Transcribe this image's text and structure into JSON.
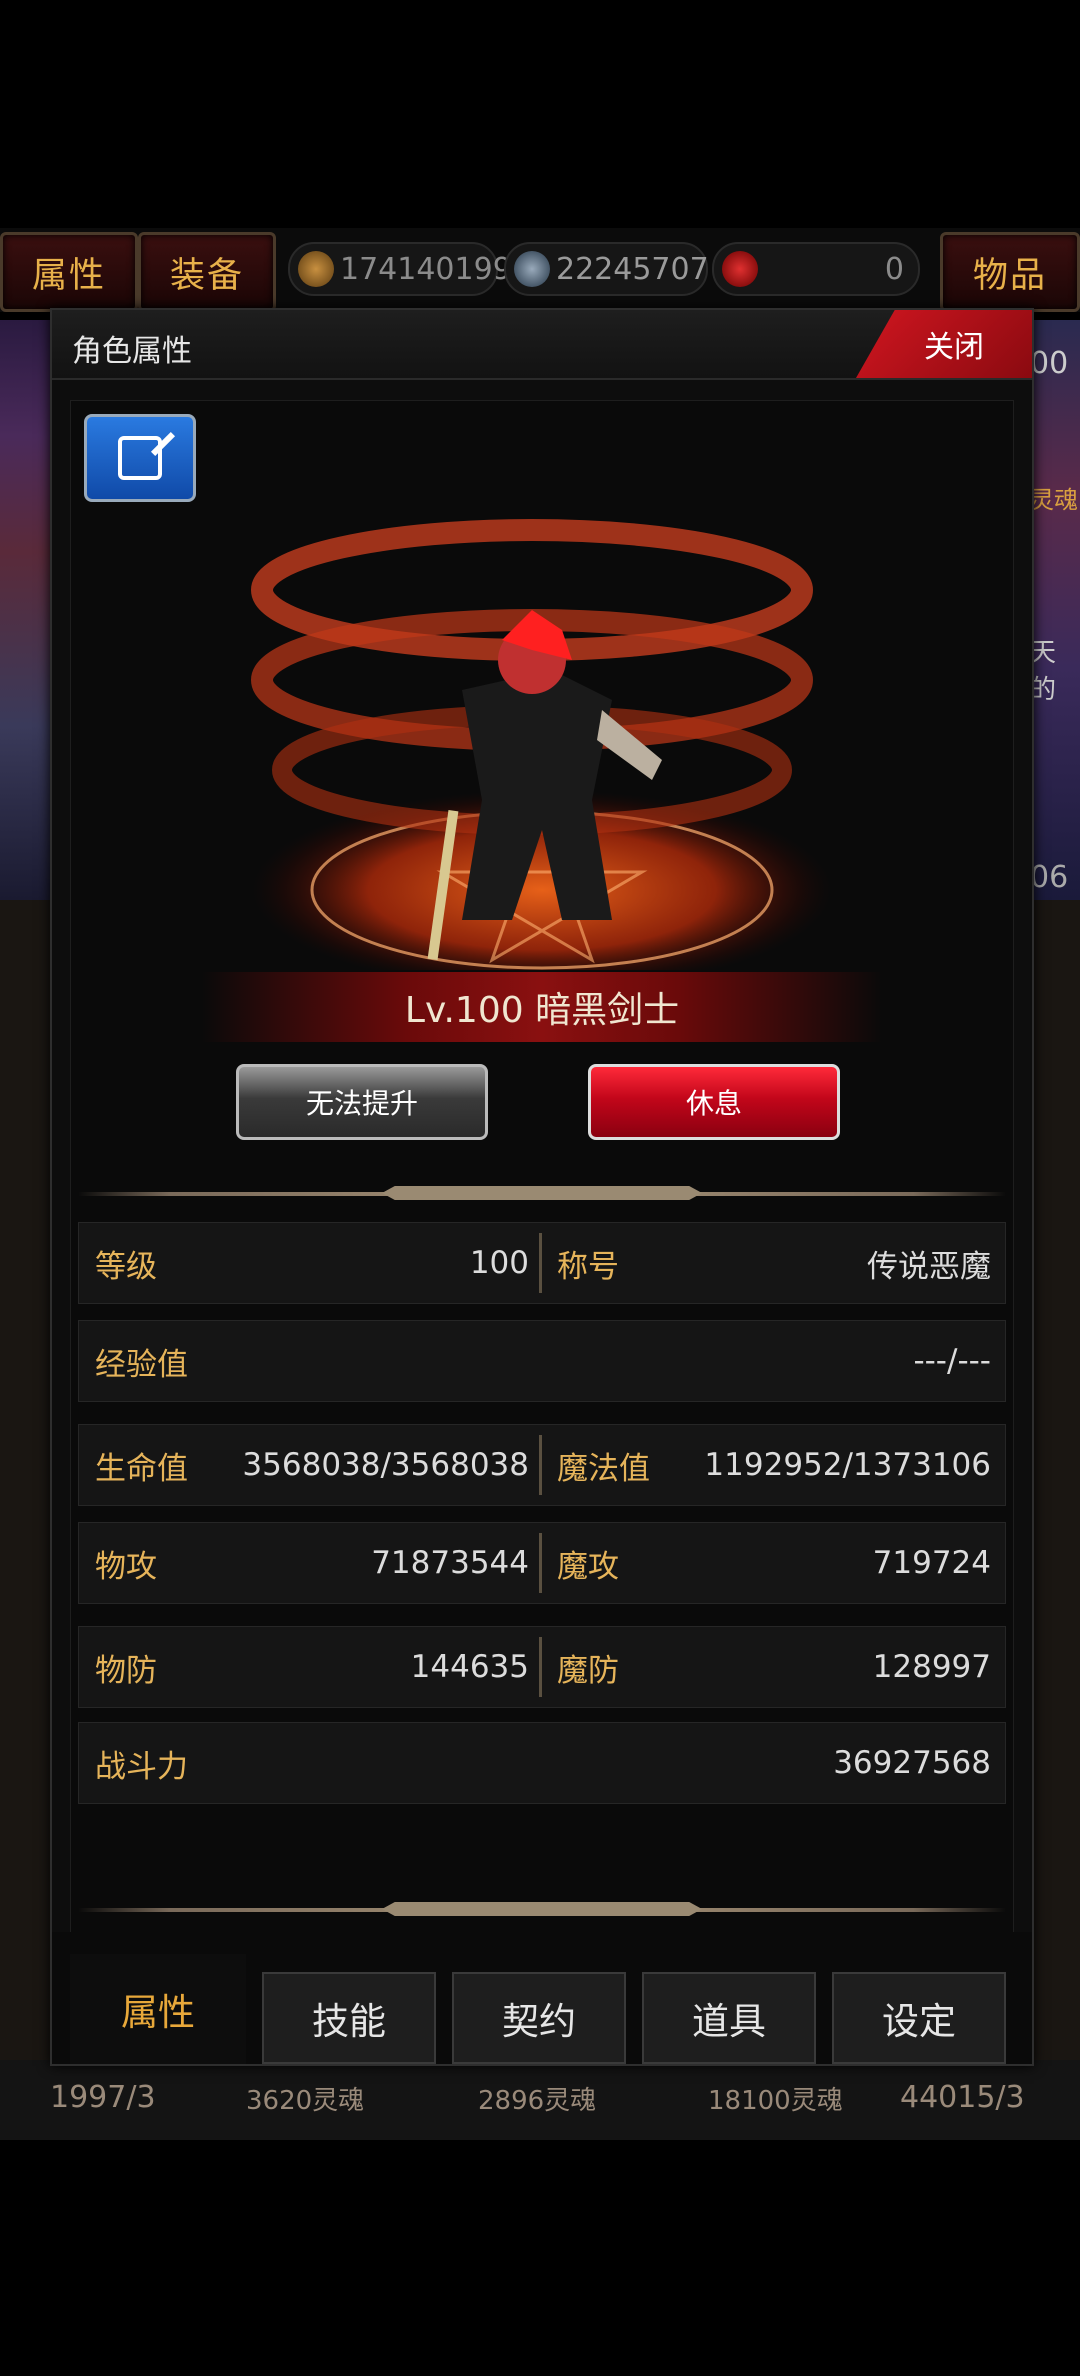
{
  "top_bar": {
    "tabs": [
      "属性",
      "装备"
    ],
    "items_label": "物品",
    "currencies": [
      {
        "icon": "gold-coin-icon",
        "value": "174140199"
      },
      {
        "icon": "blue-skull-gem-icon",
        "value": "22245707"
      },
      {
        "icon": "red-token-icon",
        "value": "0"
      }
    ]
  },
  "background": {
    "right_texts": [
      "00",
      "灵魂",
      "天的",
      "06"
    ],
    "bottom_items": [
      "1997/3",
      "3620灵魂",
      "2896灵魂",
      "18100灵魂",
      "44015/3"
    ]
  },
  "dialog": {
    "title": "角色属性",
    "close_label": "关闭",
    "character": {
      "level_label": "Lv.100 暗黑剑士"
    },
    "buttons": {
      "upgrade": "无法提升",
      "rest": "休息"
    },
    "stats": {
      "level": {
        "label": "等级",
        "value": "100"
      },
      "title": {
        "label": "称号",
        "value": "传说恶魔"
      },
      "exp": {
        "label": "经验值",
        "value": "---/---"
      },
      "hp": {
        "label": "生命值",
        "value": "3568038/3568038"
      },
      "mp": {
        "label": "魔法值",
        "value": "1192952/1373106"
      },
      "patk": {
        "label": "物攻",
        "value": "71873544"
      },
      "matk": {
        "label": "魔攻",
        "value": "719724"
      },
      "pdef": {
        "label": "物防",
        "value": "144635"
      },
      "mdef": {
        "label": "魔防",
        "value": "128997"
      },
      "power": {
        "label": "战斗力",
        "value": "36927568"
      }
    },
    "tabs": [
      "属性",
      "技能",
      "契约",
      "道具",
      "设定"
    ]
  },
  "colors": {
    "accent_gold": "#e6b45a",
    "close_red": "#d11620",
    "rest_red": "#c2061a"
  }
}
